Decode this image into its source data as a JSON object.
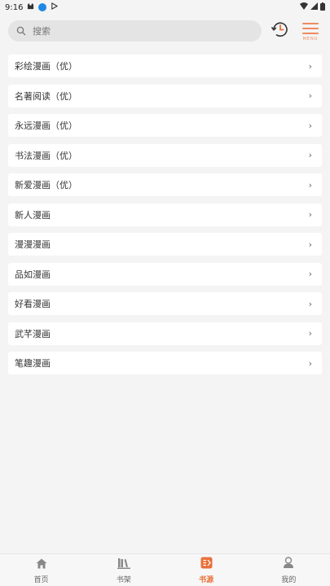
{
  "status": {
    "time": "9:16"
  },
  "search": {
    "placeholder": "搜索"
  },
  "header": {
    "menu_label": "MENU"
  },
  "sources": [
    {
      "label": "彩绘漫画（优）"
    },
    {
      "label": "名著阅读（优）"
    },
    {
      "label": "永远漫画（优）"
    },
    {
      "label": "书法漫画（优）"
    },
    {
      "label": "新爱漫画（优）"
    },
    {
      "label": "新人漫画"
    },
    {
      "label": "漫漫漫画"
    },
    {
      "label": "品如漫画"
    },
    {
      "label": "好看漫画"
    },
    {
      "label": "武芊漫画"
    },
    {
      "label": "笔趣漫画"
    }
  ],
  "tabs": [
    {
      "label": "首页",
      "icon": "home-icon"
    },
    {
      "label": "书架",
      "icon": "bookshelf-icon"
    },
    {
      "label": "书源",
      "icon": "source-icon",
      "active": true
    },
    {
      "label": "我的",
      "icon": "profile-icon"
    }
  ],
  "colors": {
    "accent": "#e8703a",
    "menu": "#f08a5d",
    "background": "#f4f4f4"
  }
}
